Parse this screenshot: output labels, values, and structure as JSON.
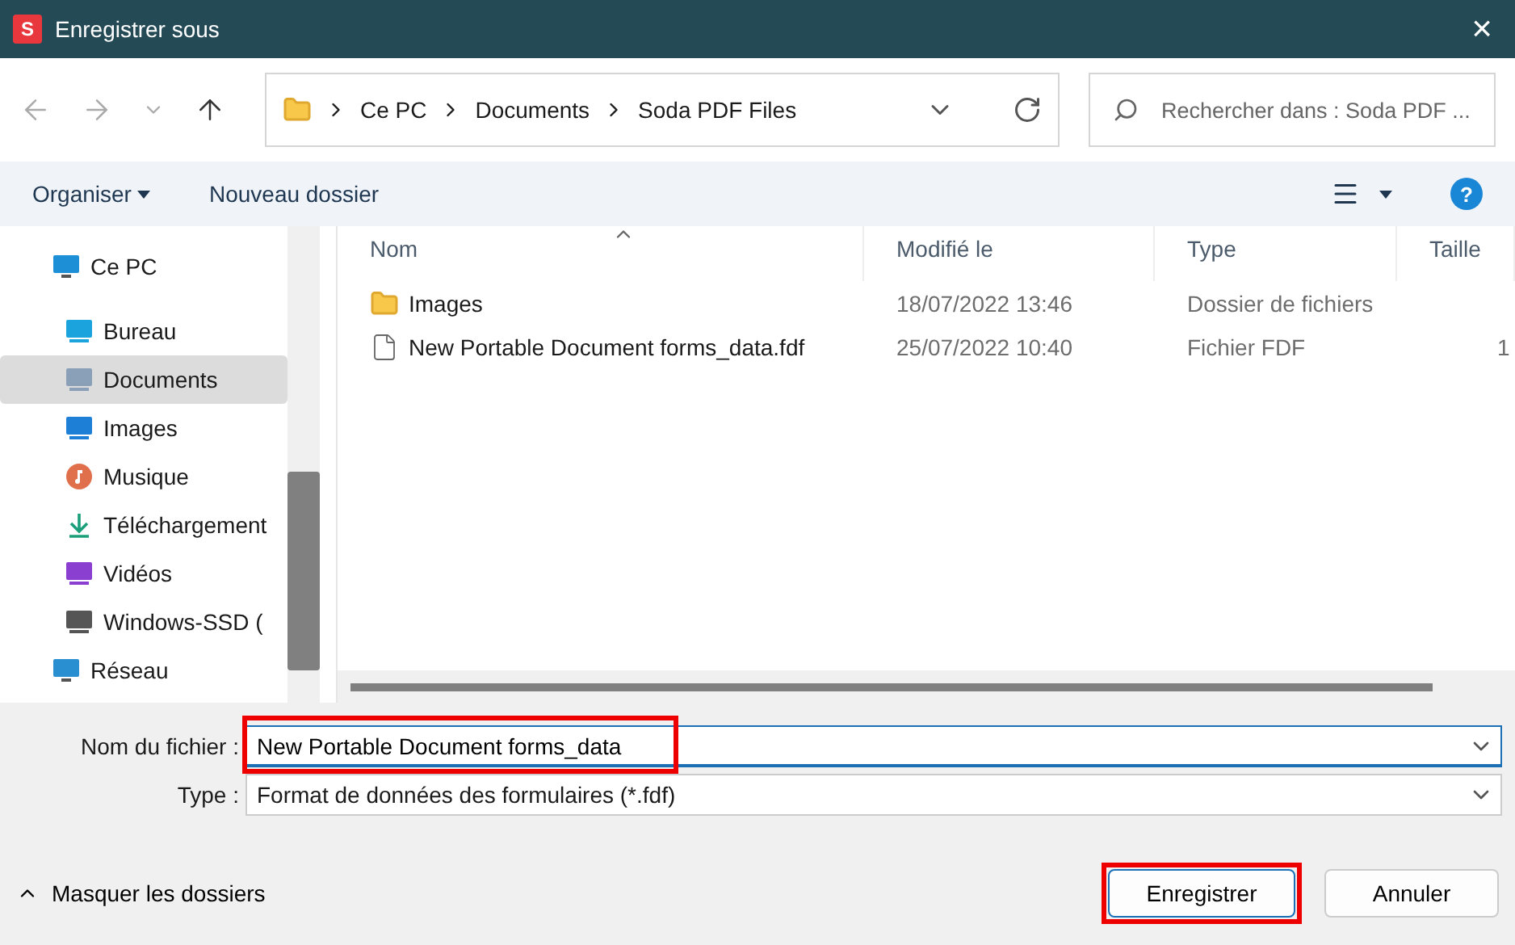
{
  "window": {
    "title": "Enregistrer sous",
    "app_icon": "S",
    "close": "×"
  },
  "nav": {
    "breadcrumb": [
      "Ce PC",
      "Documents",
      "Soda PDF Files"
    ],
    "search": {
      "placeholder": "Rechercher dans : Soda PDF ..."
    }
  },
  "toolbar": {
    "organize": "Organiser",
    "new_folder": "Nouveau dossier",
    "help": "?"
  },
  "sidebar": {
    "items": [
      {
        "label": "Ce PC",
        "kind": "pc",
        "selected": false,
        "children": [
          {
            "label": "Bureau",
            "kind": "desktop",
            "selected": false
          },
          {
            "label": "Documents",
            "kind": "documents",
            "selected": true
          },
          {
            "label": "Images",
            "kind": "pictures",
            "selected": false
          },
          {
            "label": "Musique",
            "kind": "music",
            "selected": false
          },
          {
            "label": "Téléchargement",
            "kind": "download",
            "selected": false
          },
          {
            "label": "Vidéos",
            "kind": "video",
            "selected": false
          },
          {
            "label": "Windows-SSD (",
            "kind": "drive",
            "selected": false
          }
        ]
      },
      {
        "label": "Réseau",
        "kind": "network",
        "selected": false
      }
    ]
  },
  "table": {
    "columns": [
      "Nom",
      "Modifié le",
      "Type",
      "Taille"
    ],
    "rows": [
      {
        "kind": "folder",
        "name": "Images",
        "modified": "18/07/2022 13:46",
        "type": "Dossier de fichiers"
      },
      {
        "kind": "file",
        "name": "New Portable Document forms_data.fdf",
        "modified": "25/07/2022 10:40",
        "type": "Fichier FDF",
        "size": "1"
      }
    ]
  },
  "form": {
    "filename_label": "Nom du fichier :",
    "filename": "New Portable Document forms_data",
    "filename_highlighted": true,
    "type_label": "Type :",
    "type": "Format de données des formulaires (*.fdf)"
  },
  "footer": {
    "toggle": "Masquer les dossiers",
    "save": "Enregistrer",
    "save_highlighted": true,
    "cancel": "Annuler"
  }
}
